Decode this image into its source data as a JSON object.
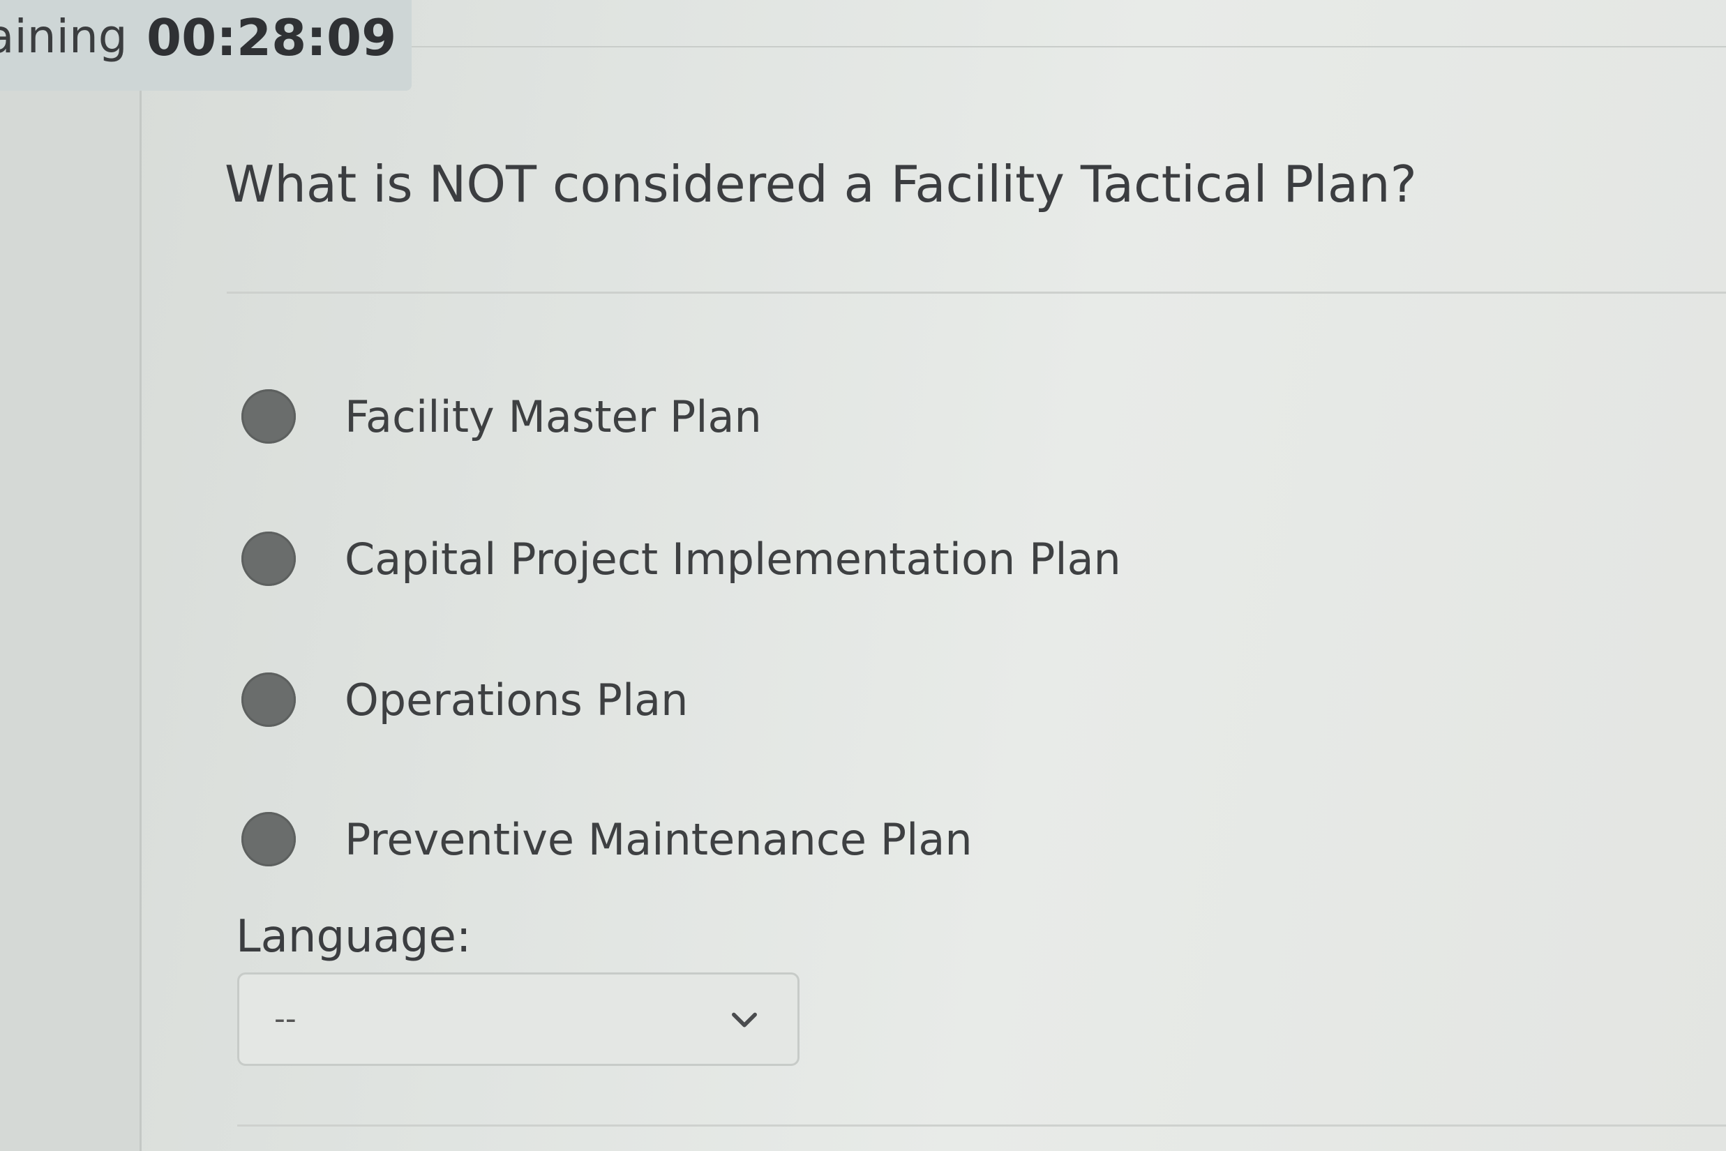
{
  "timer": {
    "label": "aining",
    "value": "00:28:09"
  },
  "question": {
    "text": "What is NOT considered a Facility Tactical Plan?",
    "options": [
      {
        "label": "Facility Master Plan"
      },
      {
        "label": "Capital Project Implementation Plan"
      },
      {
        "label": "Operations Plan"
      },
      {
        "label": "Preventive Maintenance Plan"
      }
    ]
  },
  "language": {
    "label": "Language:",
    "selected": "--"
  },
  "icons": {
    "dropdown": "chevron-down-icon"
  }
}
